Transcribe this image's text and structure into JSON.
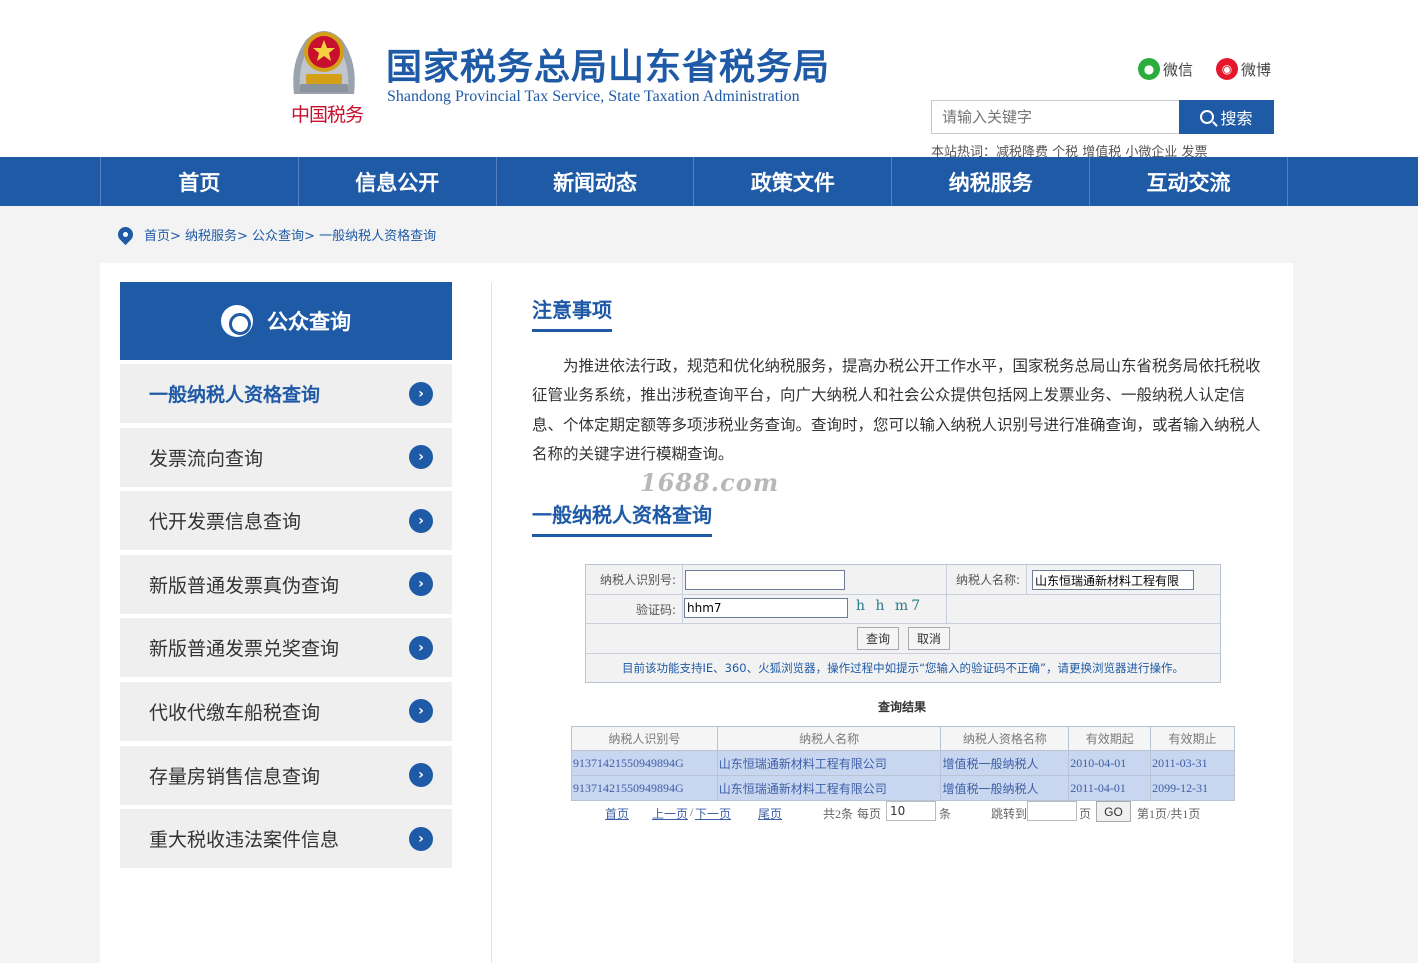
{
  "header": {
    "title": "国家税务总局山东省税务局",
    "title_en": "Shandong Provincial Tax Service, State Taxation Administration",
    "logo_text": "中国税务",
    "wechat": "微信",
    "weibo": "微博",
    "search_placeholder": "请输入关键字",
    "search_button": "搜索",
    "hot_words": "本站热词：减税降费 个税 增值税 小微企业 发票"
  },
  "nav": [
    "首页",
    "信息公开",
    "新闻动态",
    "政策文件",
    "纳税服务",
    "互动交流"
  ],
  "breadcrumb": "首页> 纳税服务> 公众查询> 一般纳税人资格查询",
  "sidebar": {
    "title": "公众查询",
    "items": [
      "一般纳税人资格查询",
      "发票流向查询",
      "代开发票信息查询",
      "新版普通发票真伪查询",
      "新版普通发票兑奖查询",
      "代收代缴车船税查询",
      "存量房销售信息查询",
      "重大税收违法案件信息"
    ]
  },
  "notice": {
    "title": "注意事项",
    "text": "为推进依法行政，规范和优化纳税服务，提高办税公开工作水平，国家税务总局山东省税务局依托税收征管业务系统，推出涉税查询平台，向广大纳税人和社会公众提供包括网上发票业务、一般纳税人认定信息、个体定期定额等多项涉税业务查询。查询时，您可以输入纳税人识别号进行准确查询，或者输入纳税人名称的关键字进行模糊查询。"
  },
  "watermark": "1688.com",
  "query": {
    "title": "一般纳税人资格查询",
    "taxpayer_id_label": "纳税人识别号:",
    "taxpayer_id_value": "",
    "taxpayer_name_label": "纳税人名称:",
    "taxpayer_name_value": "山东恒瑞通新材料工程有限",
    "captcha_label": "验证码:",
    "captcha_value": "hhm7",
    "captcha_image": "h h m7",
    "query_button": "查询",
    "cancel_button": "取消",
    "tip": "目前该功能支持IE、360、火狐浏览器，操作过程中如提示“您输入的验证码不正确”，请更换浏览器进行操作。"
  },
  "results": {
    "caption": "查询结果",
    "columns": [
      "纳税人识别号",
      "纳税人名称",
      "纳税人资格名称",
      "有效期起",
      "有效期止"
    ],
    "rows": [
      [
        "91371421550949894G",
        "山东恒瑞通新材料工程有限公司",
        "增值税一般纳税人",
        "2010-04-01",
        "2011-03-31"
      ],
      [
        "91371421550949894G",
        "山东恒瑞通新材料工程有限公司",
        "增值税一般纳税人",
        "2011-04-01",
        "2099-12-31"
      ]
    ]
  },
  "pager": {
    "first": "首页",
    "prev": "上一页",
    "sep": "/",
    "next": "下一页",
    "last": "尾页",
    "total": "共2条",
    "per_page_label": "每页",
    "per_page_value": "10",
    "per_page_unit": "条",
    "jump_label": "跳转到",
    "jump_value": "",
    "page_unit": "页",
    "go": "GO",
    "status": "第1页/共1页"
  },
  "colors": {
    "brand_blue": "#1f5aa6",
    "logo_red": "#c8102e",
    "row_highlight": "#c8d6ef"
  }
}
